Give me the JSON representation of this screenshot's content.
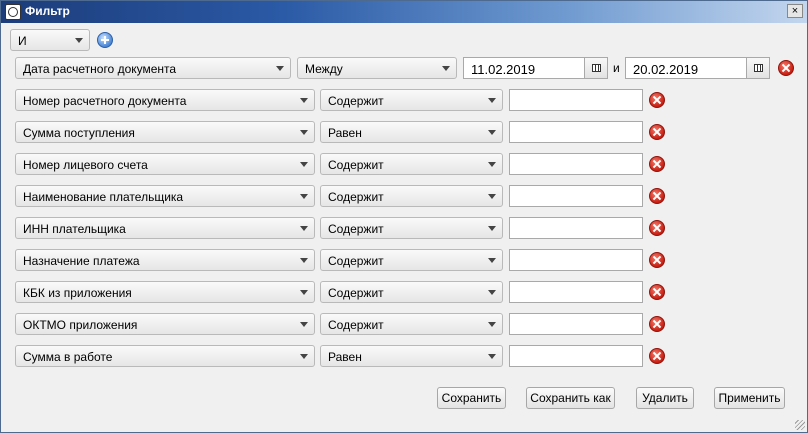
{
  "window": {
    "title": "Фильтр",
    "close_label": "×"
  },
  "logic": {
    "value": "И"
  },
  "date_row": {
    "field": "Дата расчетного документа",
    "operator": "Между",
    "from": "11.02.2019",
    "and_word": "и",
    "to": "20.02.2019"
  },
  "rows": [
    {
      "field": "Номер расчетного документа",
      "operator": "Содержит",
      "value": ""
    },
    {
      "field": "Сумма поступления",
      "operator": "Равен",
      "value": ""
    },
    {
      "field": "Номер лицевого счета",
      "operator": "Содержит",
      "value": ""
    },
    {
      "field": "Наименование плательщика",
      "operator": "Содержит",
      "value": ""
    },
    {
      "field": "ИНН плательщика",
      "operator": "Содержит",
      "value": ""
    },
    {
      "field": "Назначение платежа",
      "operator": "Содержит",
      "value": ""
    },
    {
      "field": "КБК из приложения",
      "operator": "Содержит",
      "value": ""
    },
    {
      "field": "ОКТМО приложения",
      "operator": "Содержит",
      "value": ""
    },
    {
      "field": "Сумма в работе",
      "operator": "Равен",
      "value": ""
    }
  ],
  "buttons": {
    "save": "Сохранить",
    "save_as": "Сохранить как",
    "delete": "Удалить",
    "apply": "Применить"
  },
  "icons": {
    "add": "add-condition-icon",
    "remove": "remove-condition-icon",
    "calendar": "calendar-icon"
  }
}
